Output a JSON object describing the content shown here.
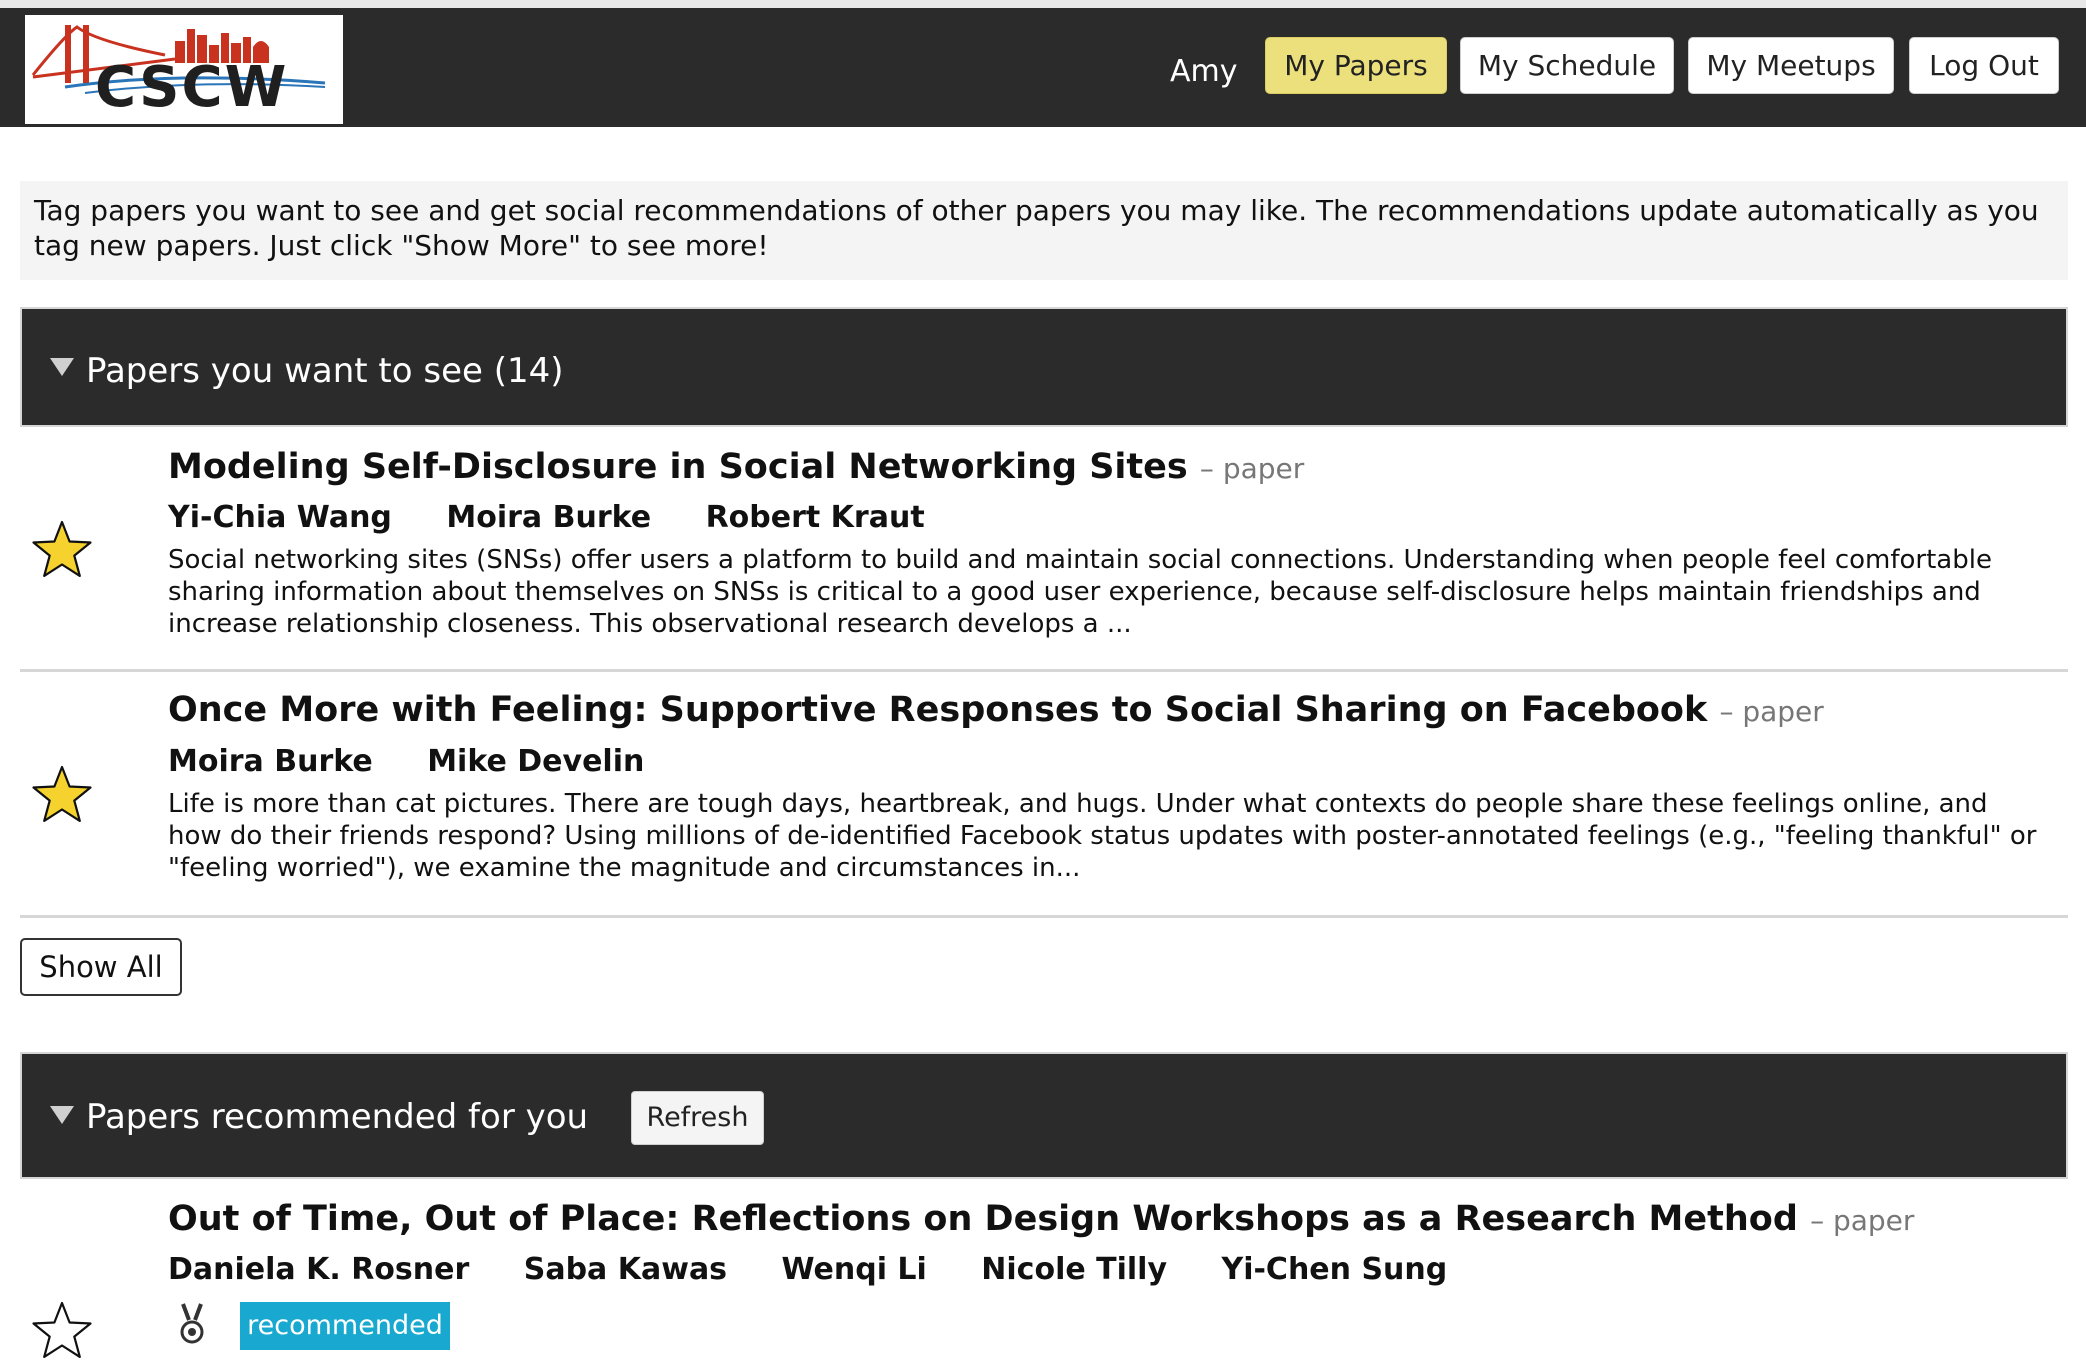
{
  "header": {
    "logo_text": "CSCW",
    "user_name": "Amy",
    "nav": {
      "my_papers": "My Papers",
      "my_schedule": "My Schedule",
      "my_meetups": "My Meetups",
      "log_out": "Log Out"
    },
    "active_nav": "my_papers"
  },
  "intro": {
    "text": "Tag papers you want to see and get social recommendations of other papers you may like. The recommendations update automatically as you tag new papers. Just click \"Show More\" to see more!"
  },
  "sections": {
    "want_to_see": {
      "title": "Papers you want to see (14)",
      "show_all_label": "Show All",
      "papers": [
        {
          "title": "Modeling Self-Disclosure in Social Networking Sites",
          "type": "– paper",
          "authors": [
            "Yi-Chia Wang",
            "Moira Burke",
            "Robert Kraut"
          ],
          "abstract": "Social networking sites (SNSs) offer users a platform to build and maintain social connections. Understanding when people feel comfortable sharing information about themselves on SNSs is critical to a good user experience, because self-disclosure helps maintain friendships and increase relationship closeness. This observational research develops a ...",
          "starred": true
        },
        {
          "title": "Once More with Feeling: Supportive Responses to Social Sharing on Facebook",
          "type": "– paper",
          "authors": [
            "Moira Burke",
            "Mike Develin"
          ],
          "abstract": "Life is more than cat pictures. There are tough days, heartbreak, and hugs. Under what contexts do people share these feelings online, and how do their friends respond? Using millions of de-identified Facebook status updates with poster-annotated feelings (e.g., \"feeling thankful\" or \"feeling worried\"), we examine the magnitude and circumstances in...",
          "starred": true
        }
      ]
    },
    "recommended": {
      "title": "Papers recommended for you",
      "refresh_label": "Refresh",
      "papers": [
        {
          "title": "Out of Time, Out of Place: Reflections on Design Workshops as a Research Method",
          "type": "– paper",
          "authors": [
            "Daniela K. Rosner",
            "Saba Kawas",
            "Wenqi Li",
            "Nicole Tilly",
            "Yi-Chen Sung"
          ],
          "badge": "recommended",
          "starred": false
        }
      ]
    }
  },
  "colors": {
    "header_bg": "#2b2b2b",
    "active_nav_bg": "#ece07d",
    "star_fill": "#f5d22e",
    "badge_bg": "#19a9d0",
    "intro_bg": "#f4f4f4"
  },
  "icons": {
    "star_filled": "star-filled-icon",
    "star_empty": "star-outline-icon",
    "collapse": "triangle-down-icon",
    "award": "medal-icon"
  }
}
